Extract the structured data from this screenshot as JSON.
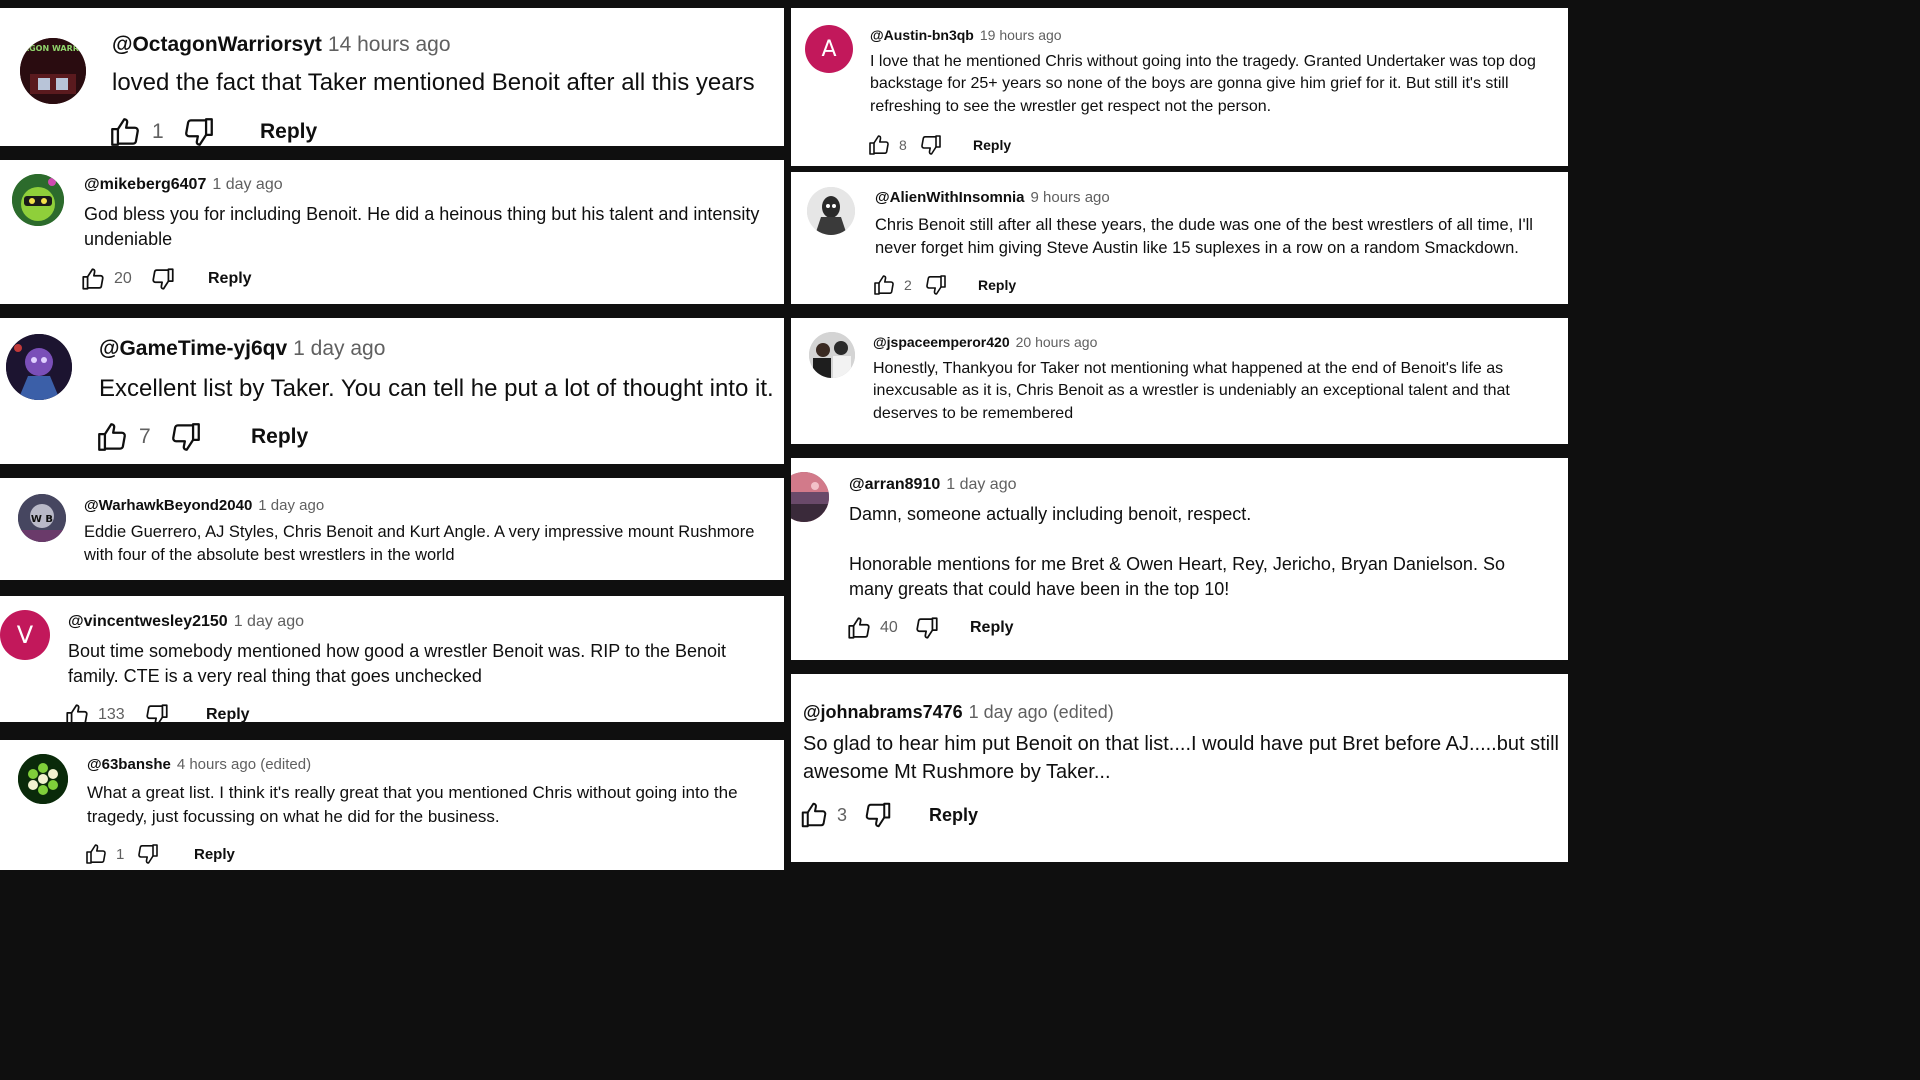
{
  "colors": {
    "background": "#0f0f0f",
    "card": "#ffffff",
    "handle": "#0f0f0f",
    "time": "#606060",
    "avatar_letter_bg": "#c2185b"
  },
  "icons": {
    "like": "thumbs-up-icon",
    "dislike": "thumbs-down-icon"
  },
  "reply_label": "Reply",
  "comments": [
    {
      "handle": "@OctagonWarriorsyt",
      "time": "14 hours ago",
      "text": [
        "loved the fact that Taker mentioned Benoit after all this years"
      ],
      "likes": "1",
      "avatar_text": "OCTAGON WARRIORS"
    },
    {
      "handle": "@mikeberg6407",
      "time": "1 day ago",
      "text": [
        "God bless you for including Benoit. He did a heinous thing but his talent and intensity undeniable"
      ],
      "likes": "20"
    },
    {
      "handle": "@GameTime-yj6qv",
      "time": "1 day ago",
      "text": [
        "Excellent list by Taker. You can tell he put a lot of thought into it."
      ],
      "likes": "7"
    },
    {
      "handle": "@WarhawkBeyond2040",
      "time": "1 day ago",
      "text": [
        "Eddie Guerrero, AJ Styles, Chris Benoit and Kurt Angle. A very impressive mount Rushmore with four of the absolute best wrestlers in the world"
      ],
      "likes": "",
      "avatar_text": "W B"
    },
    {
      "handle": "@vincentwesley2150",
      "time": "1 day ago",
      "text": [
        "Bout time somebody mentioned how good a wrestler Benoit was. RIP to the Benoit family. CTE is a very real thing that goes unchecked"
      ],
      "likes": "133",
      "avatar_letter": "V"
    },
    {
      "handle": "@63banshe",
      "time": "4 hours ago (edited)",
      "text": [
        "What a great list. I think it's really great that you mentioned Chris without going into the tragedy, just focussing on what he did for the business."
      ],
      "likes": "1"
    },
    {
      "handle": "@Austin-bn3qb",
      "time": "19 hours ago",
      "text": [
        "I love that he mentioned Chris without going into the tragedy. Granted Undertaker was top dog backstage for 25+ years so none of the boys are gonna give him grief for it. But still it's still refreshing to see the wrestler get respect not the person."
      ],
      "likes": "8",
      "avatar_letter": "A"
    },
    {
      "handle": "@AlienWithInsomnia",
      "time": "9 hours ago",
      "text": [
        "Chris Benoit still after all these years, the dude was one of the best wrestlers of all time, I'll never forget him giving Steve Austin like 15 suplexes in a row on a random Smackdown."
      ],
      "likes": "2"
    },
    {
      "handle": "@jspaceemperor420",
      "time": "20 hours ago",
      "text": [
        "Honestly, Thankyou for Taker not mentioning what happened at the end of Benoit's life as inexcusable as it is, Chris Benoit as a wrestler is undeniably an exceptional talent and that deserves to be remembered"
      ],
      "likes": ""
    },
    {
      "handle": "@arran8910",
      "time": "1 day ago",
      "text": [
        "Damn, someone actually including benoit, respect.",
        "Honorable mentions for me Bret & Owen Heart, Rey, Jericho, Bryan Danielson. So many greats that could have been in the top 10!"
      ],
      "likes": "40"
    },
    {
      "handle": "@johnabrams7476",
      "time": "1 day ago (edited)",
      "text": [
        "So glad to hear him put Benoit on that list....I would have put Bret before AJ.....but still awesome Mt Rushmore by Taker..."
      ],
      "likes": "3"
    }
  ]
}
